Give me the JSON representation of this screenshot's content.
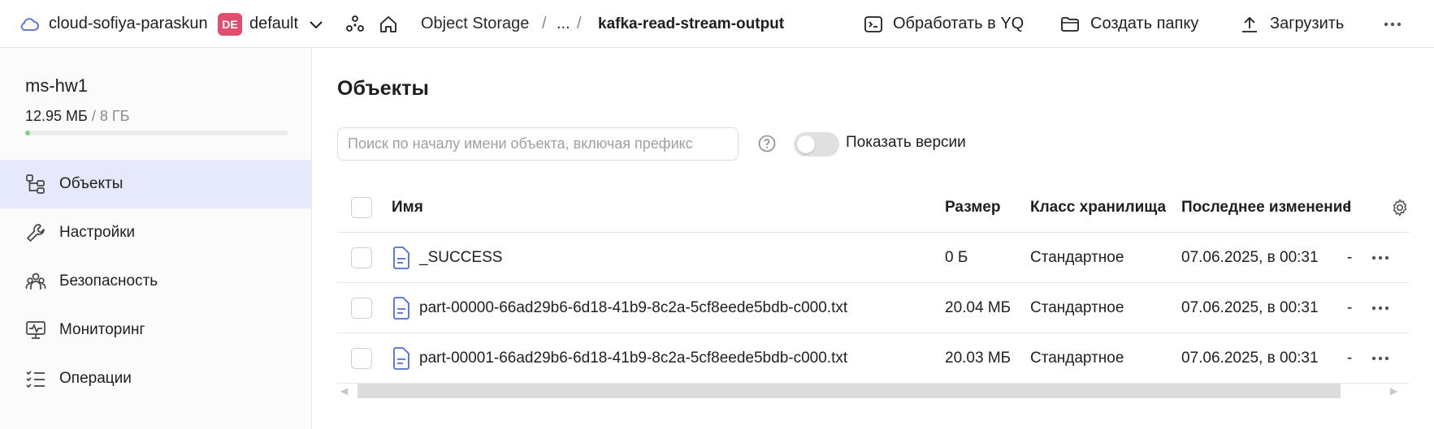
{
  "topbar": {
    "cloud_name": "cloud-sofiya-paraskun",
    "folder_badge": "DE",
    "folder_name": "default",
    "breadcrumb_service": "Object Storage",
    "breadcrumb_sep": "/",
    "breadcrumb_ellipsis": "...",
    "breadcrumb_current": "kafka-read-stream-output",
    "action_yq": "Обработать в YQ",
    "action_mkdir": "Создать папку",
    "action_upload": "Загрузить",
    "badge_color": "#e14f6e"
  },
  "sidebar": {
    "bucket_name": "ms-hw1",
    "usage_used": "12.95 МБ",
    "usage_total": " / 8 ГБ",
    "usage_fraction": 0.0016,
    "items": [
      {
        "label": "Объекты",
        "icon": "objects-icon",
        "active": true
      },
      {
        "label": "Настройки",
        "icon": "wrench-icon",
        "active": false
      },
      {
        "label": "Безопасность",
        "icon": "users-icon",
        "active": false
      },
      {
        "label": "Мониторинг",
        "icon": "monitor-icon",
        "active": false
      },
      {
        "label": "Операции",
        "icon": "list-icon",
        "active": false
      }
    ]
  },
  "main": {
    "title": "Объекты",
    "search_placeholder": "Поиск по началу имени объекта, включая префикс",
    "show_versions_label": "Показать версии",
    "show_versions_on": false,
    "table": {
      "headers": {
        "name": "Имя",
        "size": "Размер",
        "storage_class": "Класс хранилища",
        "modified": "Последнее изменение",
        "truncated": "I"
      },
      "rows": [
        {
          "name": "_SUCCESS",
          "size": "0 Б",
          "storage_class": "Стандартное",
          "modified": "07.06.2025, в 00:31",
          "truncated": "-"
        },
        {
          "name": "part-00000-66ad29b6-6d18-41b9-8c2a-5cf8eede5bdb-c000.txt",
          "size": "20.04 МБ",
          "storage_class": "Стандартное",
          "modified": "07.06.2025, в 00:31",
          "truncated": "-"
        },
        {
          "name": "part-00001-66ad29b6-6d18-41b9-8c2a-5cf8eede5bdb-c000.txt",
          "size": "20.03 МБ",
          "storage_class": "Стандартное",
          "modified": "07.06.2025, в 00:31",
          "truncated": "-"
        }
      ]
    }
  },
  "colors": {
    "accent": "#4d6bdb",
    "active_nav_bg": "#e5e9fb",
    "usage_fill": "#7ed08a"
  }
}
